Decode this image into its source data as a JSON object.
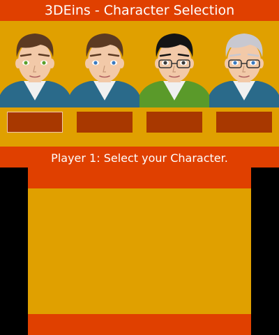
{
  "title": "3DEins - Character Selection",
  "status": "Player 1: Select your Character.",
  "colors": {
    "background": "#e0a000",
    "bar": "#e04000",
    "slot": "#a83800",
    "screen_border": "#000000",
    "text": "#ffffff"
  },
  "characters": [
    {
      "hair": "#5c3a22",
      "eyes": "#5aa02c",
      "jacket": "#2a6a8a",
      "glasses": false,
      "selected": true
    },
    {
      "hair": "#5c3a22",
      "eyes": "#3a7ac0",
      "jacket": "#2a6a8a",
      "glasses": false,
      "selected": false
    },
    {
      "hair": "#141414",
      "eyes": "#3a3a3a",
      "jacket": "#5a9a2a",
      "glasses": true,
      "selected": false
    },
    {
      "hair": "#c8c8d0",
      "eyes": "#3a7ac0",
      "jacket": "#2a6a8a",
      "glasses": true,
      "selected": false
    }
  ]
}
